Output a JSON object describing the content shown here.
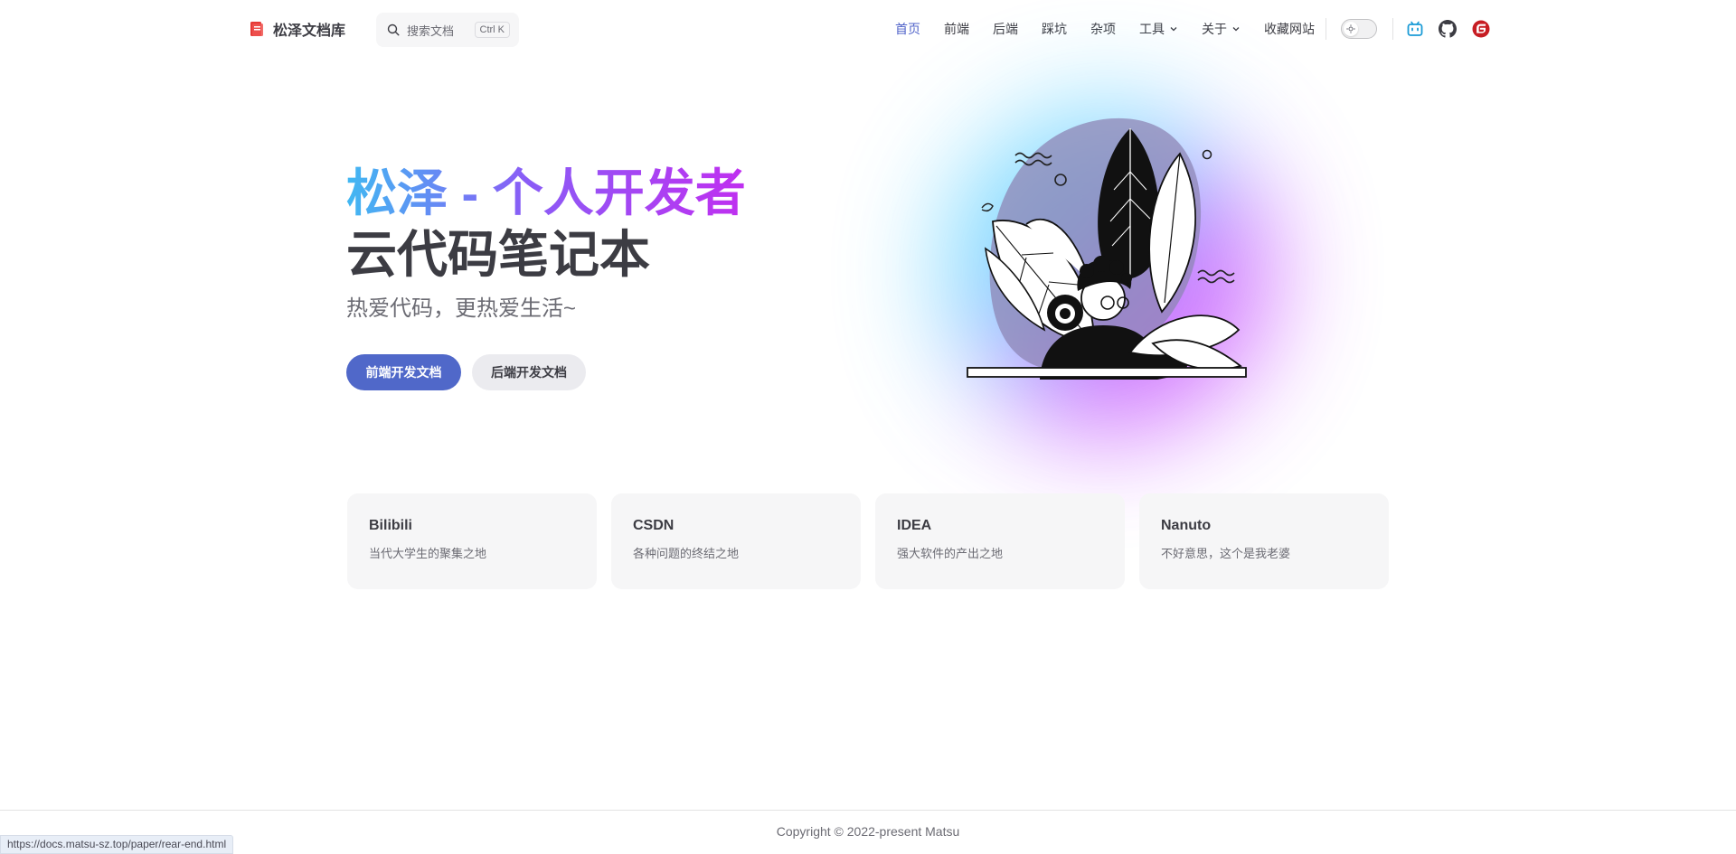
{
  "brand": {
    "title": "松泽文档库",
    "logo_icon": "book-logo-icon"
  },
  "search": {
    "placeholder": "搜索文档",
    "shortcut": "Ctrl K"
  },
  "nav": {
    "items": [
      {
        "label": "首页",
        "active": true
      },
      {
        "label": "前端",
        "active": false
      },
      {
        "label": "后端",
        "active": false
      },
      {
        "label": "踩坑",
        "active": false
      },
      {
        "label": "杂项",
        "active": false
      },
      {
        "label": "工具",
        "active": false,
        "dropdown": true
      },
      {
        "label": "关于",
        "active": false,
        "dropdown": true
      },
      {
        "label": "收藏网站",
        "active": false
      }
    ],
    "theme_toggle": "light-mode",
    "social": [
      "bilibili-icon",
      "github-icon",
      "gitee-icon"
    ]
  },
  "hero": {
    "name": "松泽 - 个人开发者",
    "text": "云代码笔记本",
    "tagline": "热爱代码，更热爱生活~",
    "actions": [
      {
        "label": "前端开发文档",
        "theme": "brand"
      },
      {
        "label": "后端开发文档",
        "theme": "alt"
      }
    ]
  },
  "features": [
    {
      "title": "Bilibili",
      "details": "当代大学生的聚集之地"
    },
    {
      "title": "CSDN",
      "details": "各种问题的终结之地"
    },
    {
      "title": "IDEA",
      "details": "强大软件的产出之地"
    },
    {
      "title": "Nanuto",
      "details": "不好意思，这个是我老婆"
    }
  ],
  "footer": {
    "copyright": "Copyright © 2022-present Matsu"
  },
  "status_bar": {
    "url": "https://docs.matsu-sz.top/paper/rear-end.html"
  },
  "colors": {
    "brand": "#5068c9",
    "active_nav": "#5063c9",
    "gradient_start": "#41b8f2",
    "gradient_end": "#c02ff0"
  }
}
